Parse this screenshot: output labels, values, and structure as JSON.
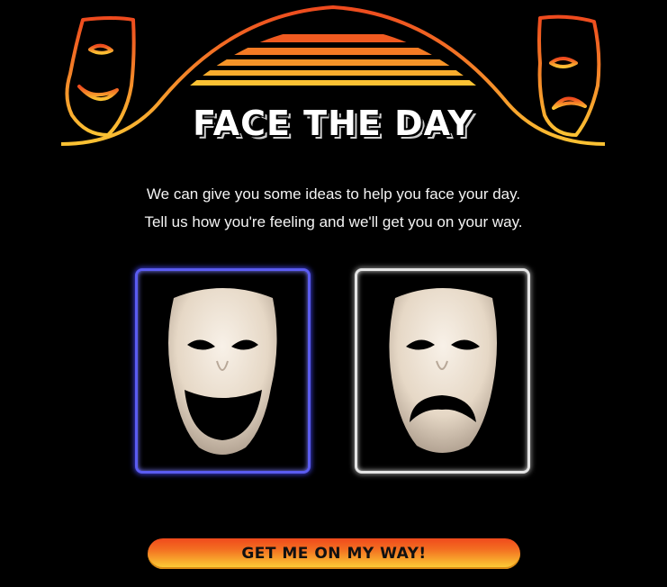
{
  "header": {
    "title": "FACE THE DAY"
  },
  "intro": {
    "line1": "We can give you some ideas to help you face your day.",
    "line2": "Tell us how you're feeling and we'll get you on your way."
  },
  "moods": {
    "options": [
      {
        "id": "happy",
        "icon": "comedy-mask-icon",
        "selected": true
      },
      {
        "id": "sad",
        "icon": "tragedy-mask-icon",
        "selected": false
      }
    ]
  },
  "cta": {
    "label": "GET ME ON MY WAY!"
  },
  "colors": {
    "background": "#000000",
    "accent_orange": "#f36d21",
    "accent_yellow": "#fcd338",
    "selected_border": "#5b5cf0",
    "unselected_border": "#e4e4e4"
  }
}
